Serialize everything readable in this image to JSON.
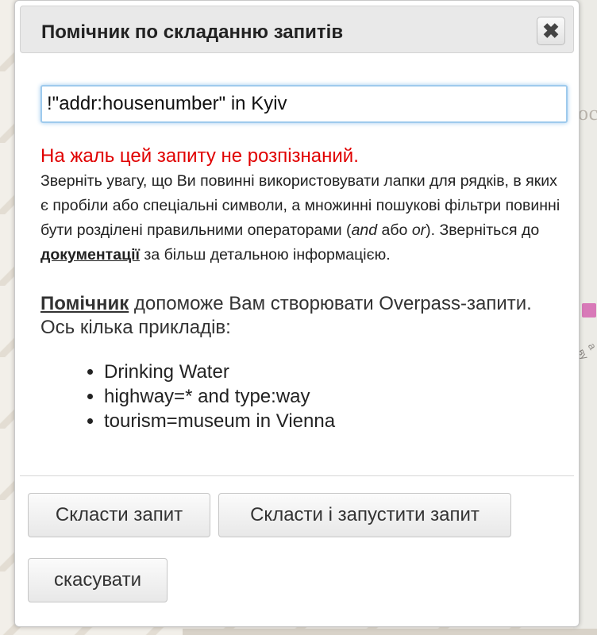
{
  "dialog": {
    "title": "Помічник по складанню запитів",
    "close_icon": "close-icon",
    "query_value": "!\"addr:housenumber\" in Kyiv",
    "error_title": "На жаль цей запиту не розпізнаний.",
    "hint": {
      "part1": "Зверніть увагу, що Ви повинні використовувати лапки для рядків, в яких є пробіли або спеціальні символи, а множинні пошукові фільтри повинні бути розділені правильними операторами (",
      "and": "and",
      "part2": " або ",
      "or": "or",
      "part3": "). Зверніться до ",
      "doc_link": "документації",
      "part4": " за більш детальною інформацією."
    },
    "helper": {
      "link": "Помічник",
      "text": " допоможе Вам створювати Overpass-запити. Ось кілька прикладів:"
    },
    "examples": [
      "Drinking Water",
      "highway=* and type:way",
      "tourism=museum in Vienna"
    ],
    "buttons": {
      "compose": "Скласти запит",
      "compose_run": "Скласти і запустити запит",
      "cancel": "скасувати"
    }
  },
  "map": {
    "label_fragment": "ос",
    "street_fragment": "а ву"
  }
}
